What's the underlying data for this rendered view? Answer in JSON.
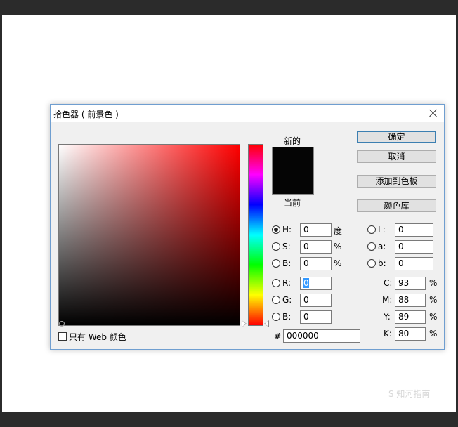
{
  "dialog": {
    "title": "拾色器 ( 前景色 )",
    "new_label": "新的",
    "current_label": "当前",
    "web_only_label": "只有 Web 颜色",
    "buttons": {
      "ok": "确定",
      "cancel": "取消",
      "add_swatch": "添加到色板",
      "color_library": "颜色库"
    },
    "new_color": "#050505",
    "current_color": "#050505"
  },
  "hsb": [
    {
      "label": "H:",
      "value": "0",
      "unit": "度",
      "checked": true
    },
    {
      "label": "S:",
      "value": "0",
      "unit": "%",
      "checked": false
    },
    {
      "label": "B:",
      "value": "0",
      "unit": "%",
      "checked": false
    }
  ],
  "rgb": [
    {
      "label": "R:",
      "value": "0"
    },
    {
      "label": "G:",
      "value": "0"
    },
    {
      "label": "B:",
      "value": "0"
    }
  ],
  "lab": [
    {
      "label": "L:",
      "value": "0"
    },
    {
      "label": "a:",
      "value": "0"
    },
    {
      "label": "b:",
      "value": "0"
    }
  ],
  "cmyk": [
    {
      "label": "C:",
      "value": "93",
      "unit": "%"
    },
    {
      "label": "M:",
      "value": "88",
      "unit": "%"
    },
    {
      "label": "Y:",
      "value": "89",
      "unit": "%"
    },
    {
      "label": "K:",
      "value": "80",
      "unit": "%"
    }
  ],
  "hex": {
    "label": "#",
    "value": "000000"
  },
  "watermark": "S 知河指南"
}
